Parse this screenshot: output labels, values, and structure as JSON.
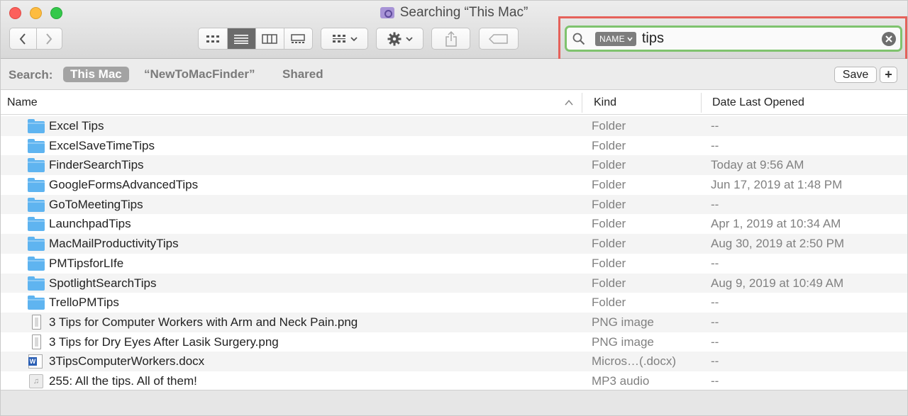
{
  "window": {
    "title": "Searching “This Mac”"
  },
  "toolbar": {
    "back_icon": "‹",
    "forward_icon": "›",
    "view_icons": [
      "icon-view-icon",
      "list-view-icon",
      "column-view-icon",
      "gallery-view-icon"
    ],
    "active_view": "list"
  },
  "search": {
    "token_label": "NAME",
    "query": "tips",
    "highlight_color": "#e5615a",
    "field_border_color": "#7fc36e"
  },
  "scope": {
    "label": "Search:",
    "options": [
      "This Mac",
      "“NewToMacFinder”",
      "Shared"
    ],
    "selected": "This Mac",
    "save_label": "Save",
    "add_label": "+"
  },
  "columns": {
    "name": "Name",
    "kind": "Kind",
    "date": "Date Last Opened"
  },
  "files": [
    {
      "name": "Excel Tips",
      "kind": "Folder",
      "date": "--",
      "icon": "folder"
    },
    {
      "name": "ExcelSaveTimeTips",
      "kind": "Folder",
      "date": "--",
      "icon": "folder"
    },
    {
      "name": "FinderSearchTips",
      "kind": "Folder",
      "date": "Today at 9:56 AM",
      "icon": "folder"
    },
    {
      "name": "GoogleFormsAdvancedTips",
      "kind": "Folder",
      "date": "Jun 17, 2019 at 1:48 PM",
      "icon": "folder"
    },
    {
      "name": "GoToMeetingTips",
      "kind": "Folder",
      "date": "--",
      "icon": "folder"
    },
    {
      "name": "LaunchpadTips",
      "kind": "Folder",
      "date": "Apr 1, 2019 at 10:34 AM",
      "icon": "folder"
    },
    {
      "name": "MacMailProductivityTips",
      "kind": "Folder",
      "date": "Aug 30, 2019 at 2:50 PM",
      "icon": "folder"
    },
    {
      "name": "PMTipsforLIfe",
      "kind": "Folder",
      "date": "--",
      "icon": "folder"
    },
    {
      "name": "SpotlightSearchTips",
      "kind": "Folder",
      "date": "Aug 9, 2019 at 10:49 AM",
      "icon": "folder"
    },
    {
      "name": "TrelloPMTips",
      "kind": "Folder",
      "date": "--",
      "icon": "folder"
    },
    {
      "name": "3 Tips for Computer Workers with Arm and Neck Pain.png",
      "kind": "PNG image",
      "date": "--",
      "icon": "png"
    },
    {
      "name": "3 Tips for Dry Eyes After Lasik Surgery.png",
      "kind": "PNG image",
      "date": "--",
      "icon": "png"
    },
    {
      "name": "3TipsComputerWorkers.docx",
      "kind": "Micros…(.docx)",
      "date": "--",
      "icon": "docx"
    },
    {
      "name": "255: All the tips. All of them!",
      "kind": "MP3 audio",
      "date": "--",
      "icon": "mp3"
    }
  ]
}
